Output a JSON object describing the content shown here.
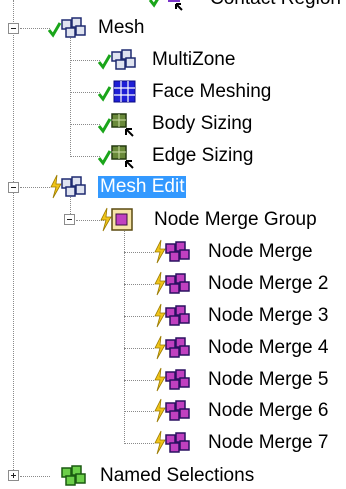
{
  "tree": {
    "top_partial": {
      "label": "Contact Region"
    },
    "mesh": {
      "label": "Mesh",
      "children": [
        {
          "label": "MultiZone"
        },
        {
          "label": "Face Meshing"
        },
        {
          "label": "Body Sizing"
        },
        {
          "label": "Edge Sizing"
        }
      ]
    },
    "mesh_edit": {
      "label": "Mesh Edit",
      "group": {
        "label": "Node Merge Group",
        "children": [
          {
            "label": "Node Merge"
          },
          {
            "label": "Node Merge 2"
          },
          {
            "label": "Node Merge 3"
          },
          {
            "label": "Node Merge 4"
          },
          {
            "label": "Node Merge 5"
          },
          {
            "label": "Node Merge 6"
          },
          {
            "label": "Node Merge 7"
          }
        ]
      }
    },
    "named_selections": {
      "label": "Named Selections"
    }
  },
  "colors": {
    "selection": "#3399ff",
    "check": "#1aa51a",
    "bolt": "#f0c419"
  }
}
